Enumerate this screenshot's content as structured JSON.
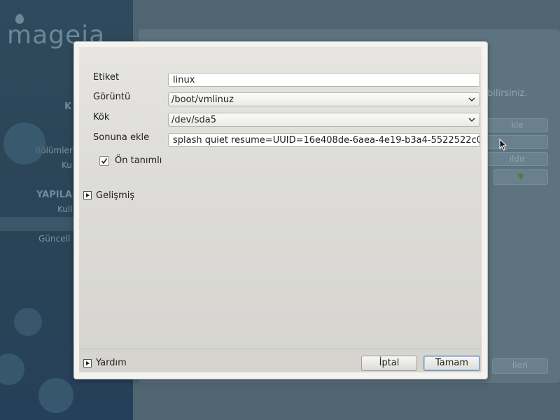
{
  "background": {
    "logo_text": "mageia",
    "sidebar": {
      "k_partial": "K",
      "bolumler_partial": "Bölümler",
      "ku_partial": "Ku",
      "yapila_partial": "YAPILA",
      "kull_partial": "Kull",
      "guncell_partial": "Güncell"
    },
    "main": {
      "hint_partial": "bilirsiniz.",
      "btn1_partial": "kle",
      "btn2_partial": "",
      "btn3_partial": "ıldır",
      "next_partial": "İleri"
    }
  },
  "dialog": {
    "fields": {
      "label_label": "Etiket",
      "label_value": "linux",
      "image_label": "Görüntü",
      "image_value": "/boot/vmlinuz",
      "root_label": "Kök",
      "root_value": "/dev/sda5",
      "append_label": "Sonuna ekle",
      "append_value": "splash quiet resume=UUID=16e408de-6aea-4e19-b3a4-5522522c0"
    },
    "default_checkbox_label": "Ön tanımlı",
    "default_checked": true,
    "advanced_label": "Gelişmiş",
    "help_label": "Yardım",
    "cancel_label": "İptal",
    "ok_label": "Tamam"
  }
}
